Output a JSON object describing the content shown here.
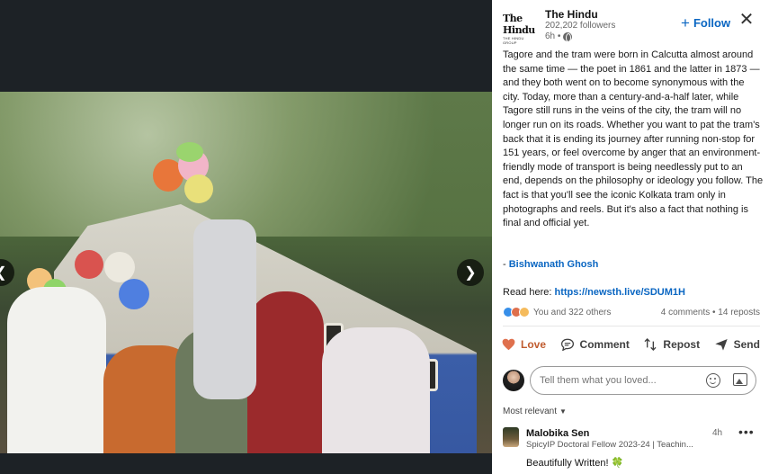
{
  "post": {
    "org": {
      "name": "The Hindu",
      "logo_text": "The Hindu",
      "logo_subtext": "THE HINDU GROUP",
      "followers": "202,202 followers",
      "time": "6h •"
    },
    "follow_label": "Follow",
    "follow_plus": "+",
    "close_symbol": "✕",
    "body_text": "Tagore and the tram were born in Calcutta almost around the same time — the poet in 1861 and the latter in 1873 — and they both went on to become synonymous with the city. Today, more than a century-and-a-half later, while Tagore still runs in the veins of the city, the tram will no longer run on its roads. Whether you want to pat the tram's back that it is ending its journey after running non-stop for 151 years, or feel overcome by anger that an environment-friendly mode of transport is being needlessly put to an end, depends on the philosophy or ideology you follow. The fact is that you'll see the iconic Kolkata tram only in photographs and reels. But it's also a fact that nothing is final and official yet.",
    "author_prefix": "- ",
    "author_name": "Bishwanath Ghosh",
    "read_here_label": "Read here: ",
    "read_here_link": "https://newsth.live/SDUM1H",
    "reactions_text": "You and 322 others",
    "comment_stats": "4 comments • 14 reposts",
    "actions": {
      "love": "Love",
      "comment": "Comment",
      "repost": "Repost",
      "send": "Send"
    },
    "comment_placeholder": "Tell them what you loved...",
    "sort_label": "Most relevant",
    "sort_caret": "▼"
  },
  "comment": {
    "name": "Malobika Sen",
    "headline": "SpicyIP Doctoral Fellow 2023-24 | Teachin...",
    "time": "4h",
    "more": "•••",
    "text": "Beautifully Written! 🍀"
  },
  "media": {
    "prev_arrow": "❮",
    "next_arrow": "❯"
  },
  "colors": {
    "accent": "#0a66c2",
    "love": "#c05b2e",
    "media_bg": "#1d2226"
  }
}
